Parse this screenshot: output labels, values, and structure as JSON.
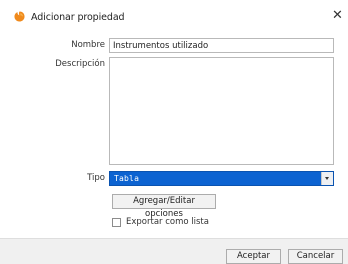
{
  "window": {
    "title": "Adicionar propiedad",
    "close_symbol": "✕",
    "icon": "app-logo-icon",
    "accent": "#0c63d1"
  },
  "form": {
    "name_label": "Nombre",
    "name_value": "Instrumentos utilizado",
    "description_label": "Descripción",
    "description_value": "",
    "type_label": "Tipo",
    "type_value": "Tabla",
    "options_button": "Agregar/Editar opciones",
    "export_label": "Exportar como lista",
    "export_checked": false
  },
  "footer": {
    "accept": "Aceptar",
    "cancel": "Cancelar"
  }
}
